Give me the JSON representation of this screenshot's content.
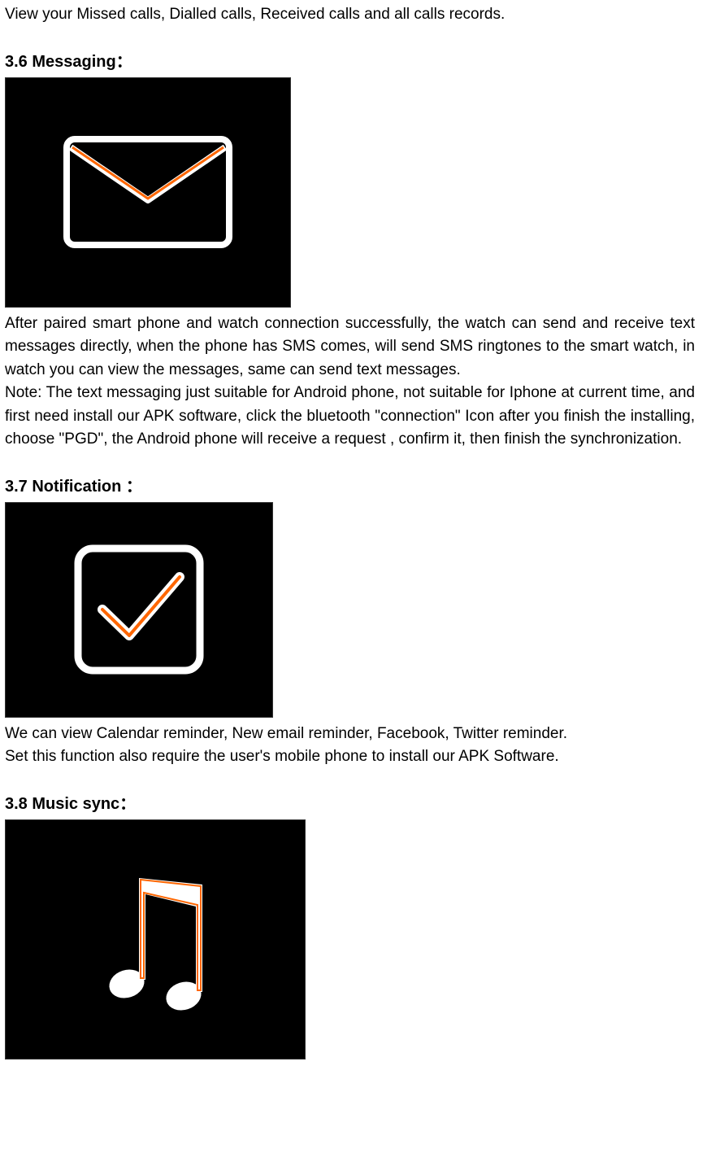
{
  "intro": "View your Missed calls, Dialled calls, Received calls and all calls records.",
  "sections": {
    "messaging": {
      "heading": "3.6 Messaging：",
      "para1": "After paired smart phone and watch connection successfully, the watch can send and receive text messages directly, when the phone has SMS comes, will send SMS ringtones to the smart watch, in watch you can view the messages, same can send text messages.",
      "para2": "Note: The text messaging just suitable for Android phone, not suitable for Iphone at current time, and first need install our APK software, click the bluetooth \"connection\" Icon after you finish the installing, choose \"PGD\", the Android phone will receive a request , confirm it, then finish the synchronization."
    },
    "notification": {
      "heading": "3.7 Notification ：",
      "para1": "We can view Calendar reminder, New email reminder, Facebook, Twitter reminder.",
      "para2": "Set this function also require the user's mobile phone to install our APK Software."
    },
    "music": {
      "heading": "3.8 Music sync："
    }
  }
}
